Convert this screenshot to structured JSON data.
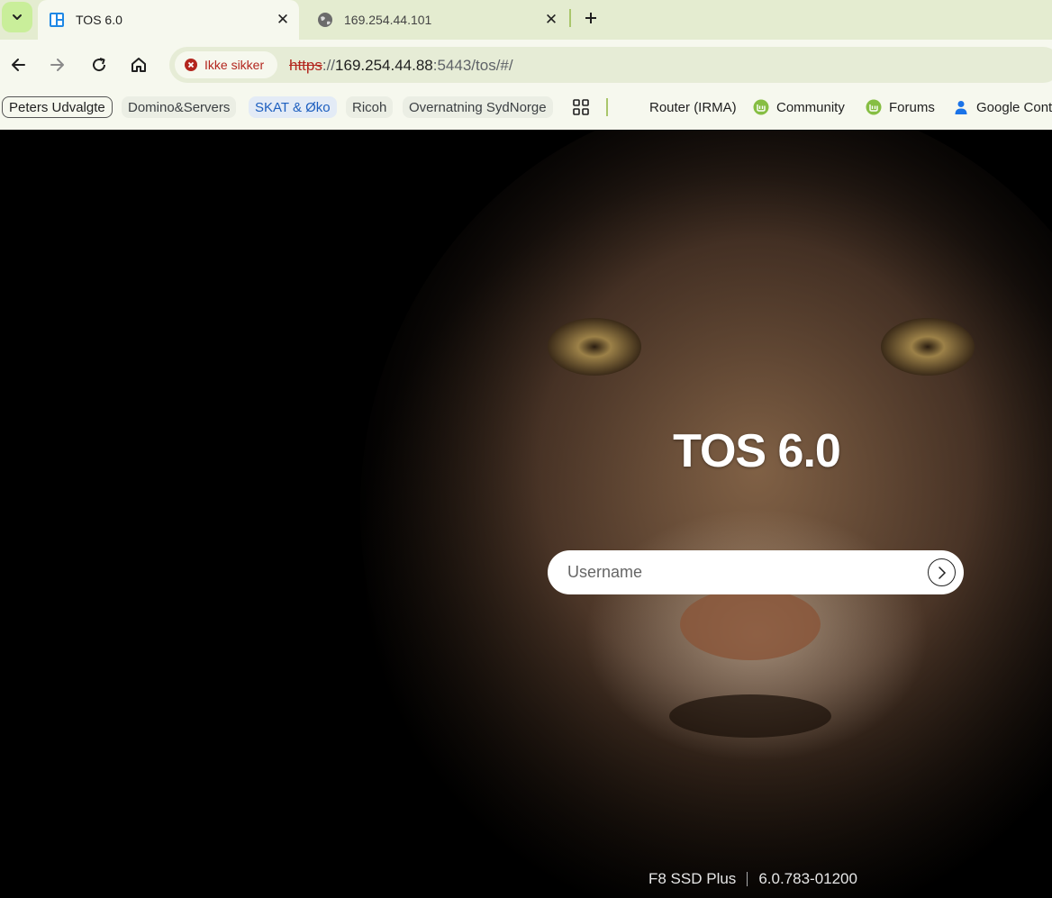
{
  "browser": {
    "tabs": [
      {
        "title": "TOS 6.0",
        "favicon": "tos-grid-icon",
        "active": true
      },
      {
        "title": "169.254.44.101",
        "favicon": "globe-icon",
        "active": false
      }
    ],
    "security_label": "Ikke sikker",
    "url": {
      "scheme": "https",
      "separator": "://",
      "host": "169.254.44.88",
      "rest": ":5443/tos/#/"
    },
    "bookmark_groups": [
      {
        "label": "Peters Udvalgte"
      },
      {
        "label": "Domino&Servers"
      },
      {
        "label": "SKAT & Øko"
      },
      {
        "label": "Ricoh"
      },
      {
        "label": "Overnatning SydNorge"
      }
    ],
    "bookmarks": [
      {
        "label": "Router (IRMA)",
        "icon": "none"
      },
      {
        "label": "Community",
        "icon": "mint-icon"
      },
      {
        "label": "Forums",
        "icon": "mint-icon"
      },
      {
        "label": "Google Cont",
        "icon": "person-icon"
      }
    ],
    "colors": {
      "tab_strip": "#e4ecd0",
      "toolbar": "#f6f8ee",
      "insecure": "#b3261e",
      "mint": "#86be43"
    }
  },
  "login": {
    "title": "TOS 6.0",
    "username_placeholder": "Username",
    "username_value": ""
  },
  "footer": {
    "model": "F8 SSD Plus",
    "version": "6.0.783-01200"
  }
}
